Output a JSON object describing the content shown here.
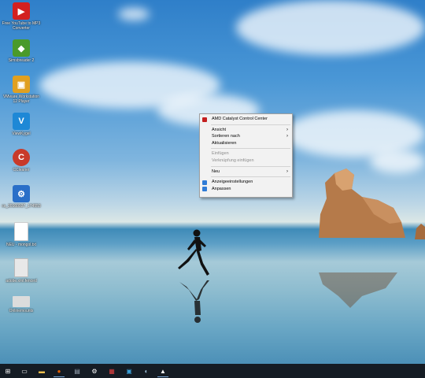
{
  "desktop_icons": [
    {
      "name": "youtube-mp3-icon",
      "label": "Free YouTube to MP3 Converter",
      "glyph": "▶",
      "color": "#d32020"
    },
    {
      "name": "sims-icon",
      "label": "Simsbreader 2",
      "glyph": "◆",
      "color": "#4a9a2a"
    },
    {
      "name": "vmware-icon",
      "label": "VMware Workstation 12 Player",
      "glyph": "▣",
      "color": "#e0a020"
    },
    {
      "name": "viewtopdf-icon",
      "label": "ViewKygel",
      "glyph": "V",
      "color": "#1e88d6"
    },
    {
      "name": "ccleaner-icon",
      "label": "CCleaner",
      "glyph": "C",
      "color": "#c83a2a"
    },
    {
      "name": "installer-icon",
      "label": "cs_20160927_174553",
      "glyph": "⚙",
      "color": "#2a6fc8"
    },
    {
      "name": "file-icon",
      "label": "NEU - mongol.txt",
      "glyph": "",
      "color": "#ffffff"
    },
    {
      "name": "document-icon",
      "label": "adobe.xml.fenced",
      "glyph": "",
      "color": "#e8e8e8"
    },
    {
      "name": "folder-icon",
      "label": "Onlinemounts",
      "glyph": "",
      "color": "#dcdcdc"
    }
  ],
  "context_menu": {
    "items": [
      {
        "label": "AMD Catalyst Control Center",
        "icon": "amd-icon",
        "icon_color": "#c41f1f",
        "disabled": false,
        "submenu": false
      },
      {
        "sep": true
      },
      {
        "label": "Ansicht",
        "disabled": false,
        "submenu": true
      },
      {
        "label": "Sortieren nach",
        "disabled": false,
        "submenu": true
      },
      {
        "label": "Aktualisieren",
        "disabled": false,
        "submenu": false
      },
      {
        "sep": true
      },
      {
        "label": "Einfügen",
        "disabled": true,
        "submenu": false
      },
      {
        "label": "Verknüpfung einfügen",
        "disabled": true,
        "submenu": false
      },
      {
        "sep": true
      },
      {
        "label": "Neu",
        "disabled": false,
        "submenu": true
      },
      {
        "sep": true
      },
      {
        "label": "Anzeigeeinstellungen",
        "icon": "display-settings-icon",
        "icon_color": "#2f7bd6",
        "disabled": false,
        "submenu": false
      },
      {
        "label": "Anpassen",
        "icon": "personalize-icon",
        "icon_color": "#2f7bd6",
        "disabled": false,
        "submenu": false
      }
    ],
    "submenu_arrow": "›"
  },
  "taskbar": {
    "items": [
      {
        "name": "start-button",
        "glyph": "⊞",
        "color": "#ffffff"
      },
      {
        "name": "task-view-button",
        "glyph": "▭",
        "color": "#ffffff"
      },
      {
        "name": "file-explorer-icon",
        "glyph": "▬",
        "color": "#f2c14e"
      },
      {
        "name": "firefox-icon",
        "glyph": "●",
        "color": "#e66000"
      },
      {
        "name": "app-icon-1",
        "glyph": "▤",
        "color": "#9aa7b5"
      },
      {
        "name": "settings-icon",
        "glyph": "⚙",
        "color": "#ffffff"
      },
      {
        "name": "app-icon-2",
        "glyph": "▦",
        "color": "#e04040"
      },
      {
        "name": "app-icon-3",
        "glyph": "▣",
        "color": "#3aa0d8"
      },
      {
        "name": "app-icon-4",
        "glyph": "◐",
        "color": "#9fc0d8"
      },
      {
        "name": "photos-icon",
        "glyph": "▲",
        "color": "#ffffff"
      }
    ]
  }
}
